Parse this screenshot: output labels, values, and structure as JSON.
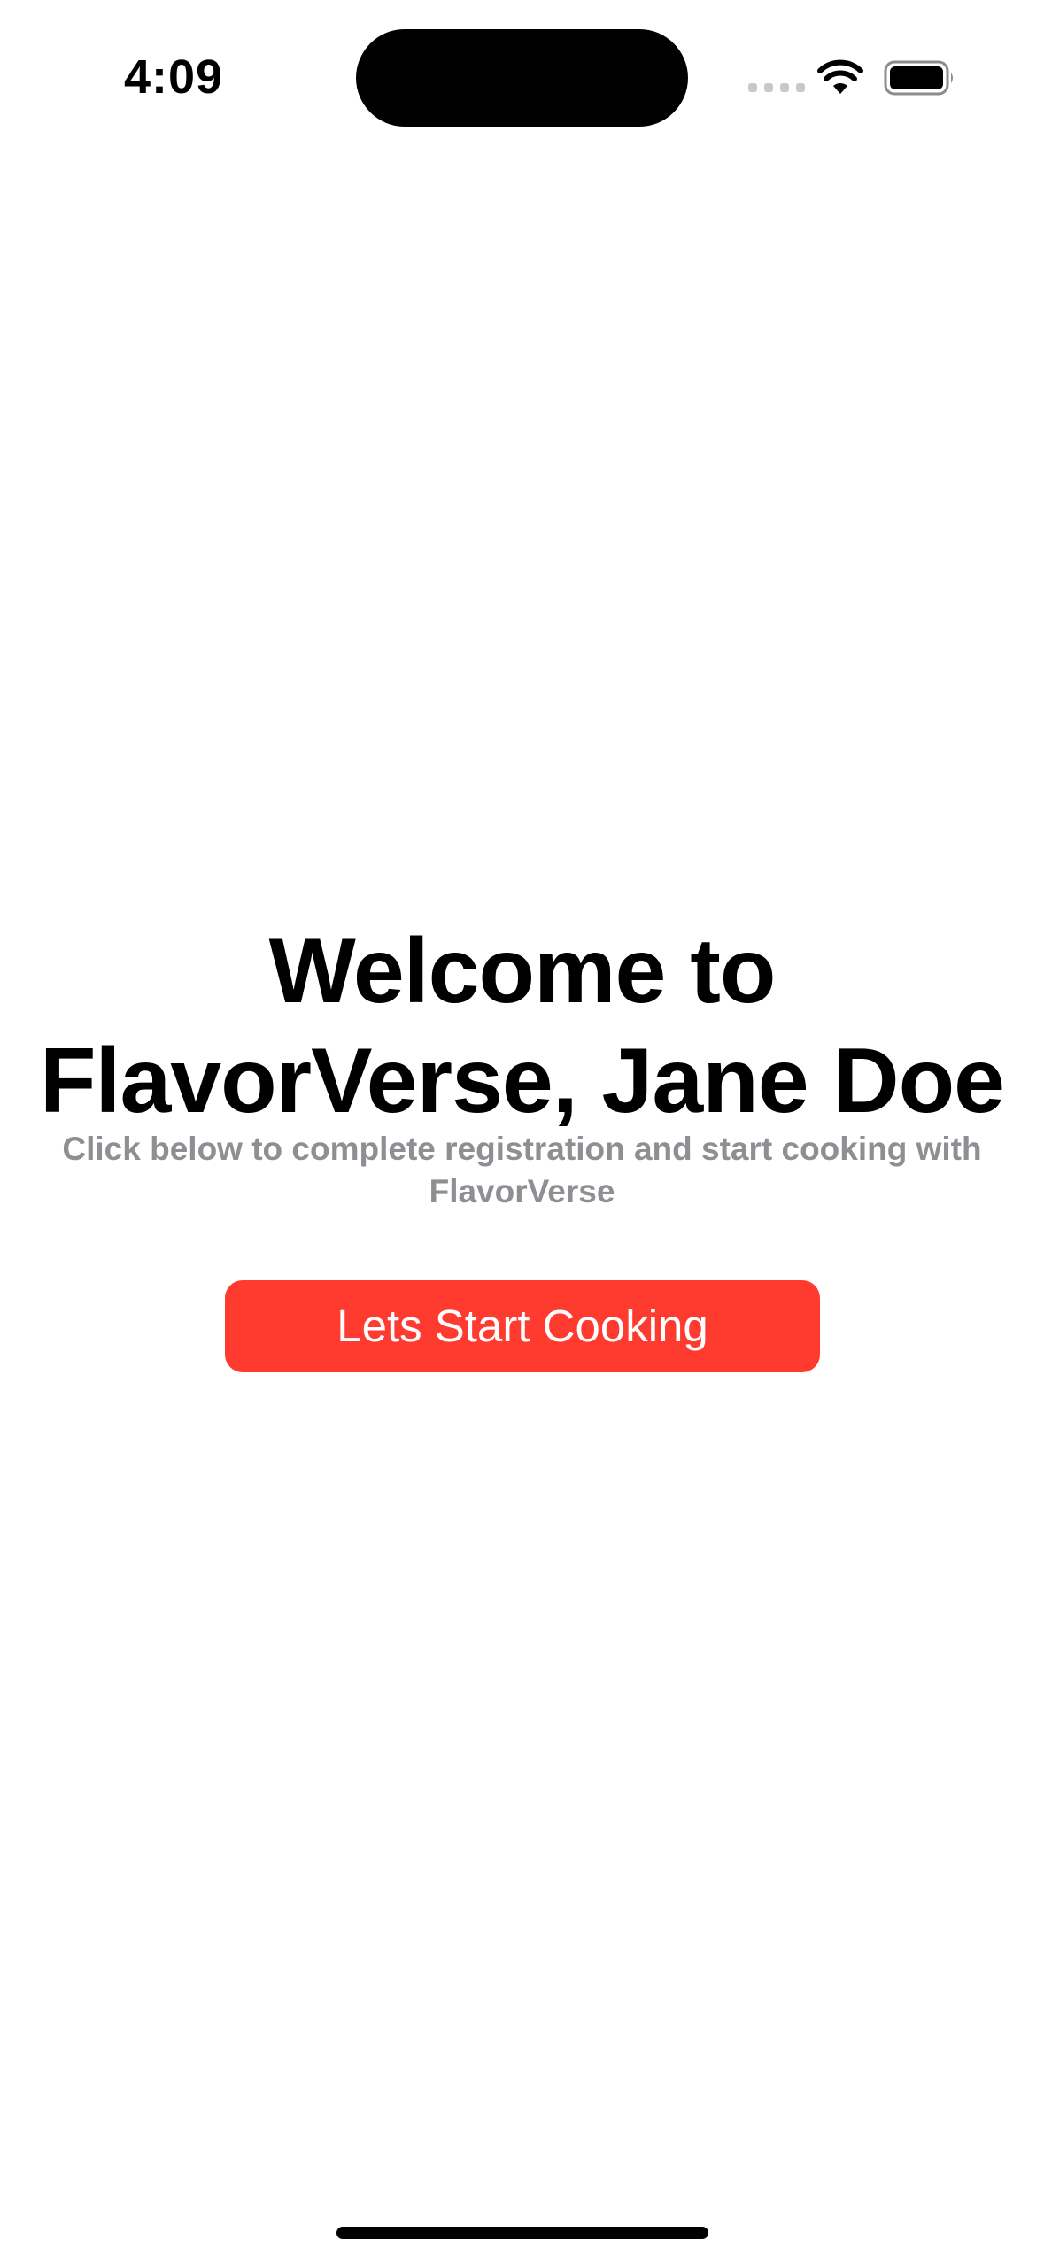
{
  "status_bar": {
    "time": "4:09",
    "icons": [
      "cellular-signal-icon",
      "wifi-icon",
      "battery-icon"
    ]
  },
  "main": {
    "title": "Welcome to FlavorVerse, Jane Doe",
    "subtitle": "Click below to complete registration and start cooking with FlavorVerse",
    "start_button_label": "Lets Start Cooking"
  },
  "colors": {
    "accent": "#ff3b30",
    "subtitle": "#8e8e93",
    "background": "#ffffff"
  }
}
